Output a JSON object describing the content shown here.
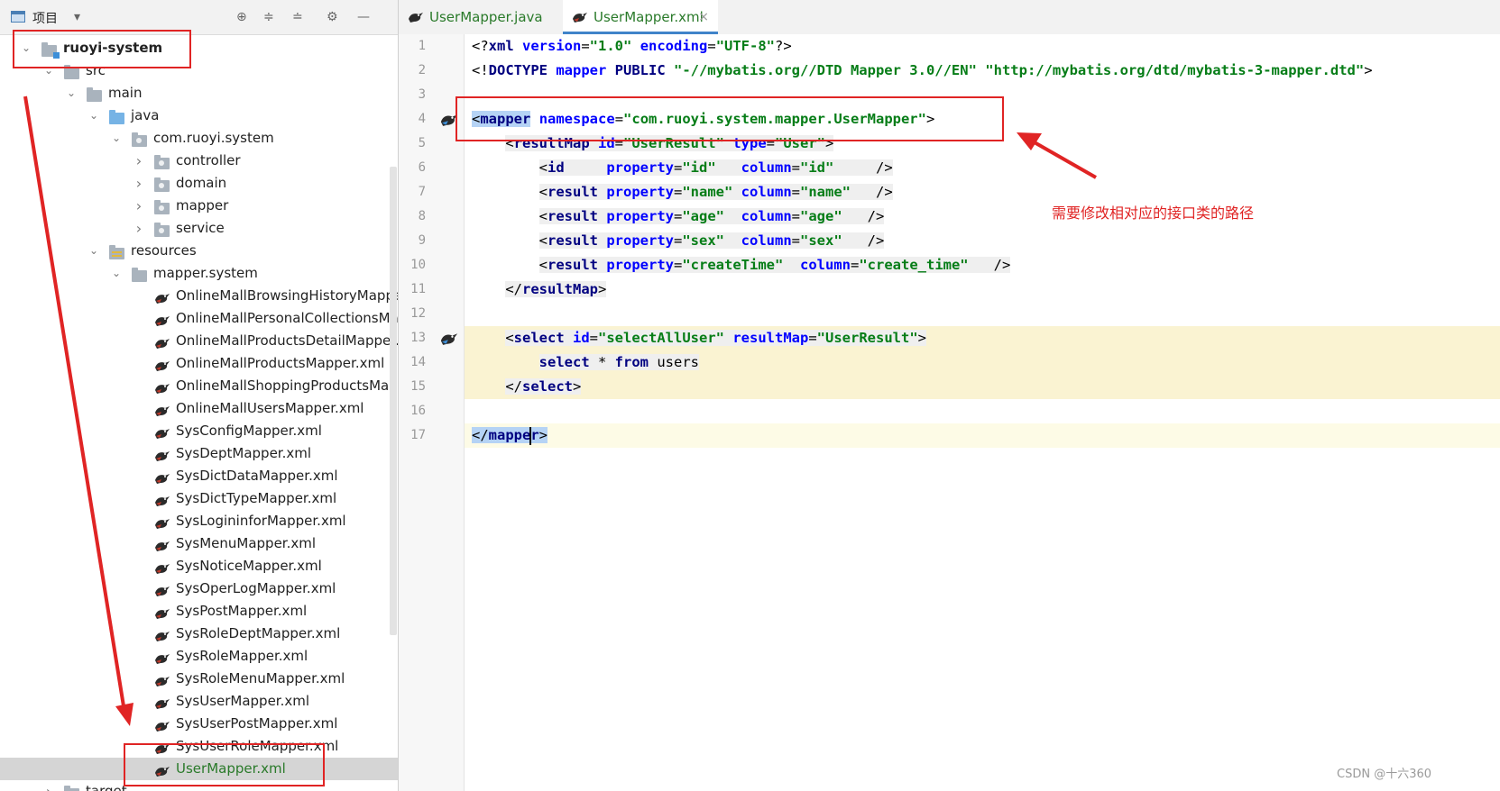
{
  "panel": {
    "title": "项目",
    "dropdown_icon": "caret-down-icon",
    "toolbar_icons": [
      "target-icon",
      "expand-all-icon",
      "collapse-all-icon",
      "gear-icon",
      "minimize-icon"
    ]
  },
  "tree": [
    {
      "label": "ruoyi-system",
      "depth": 0,
      "expanded": true,
      "icon": "module-folder-icon",
      "bold": true
    },
    {
      "label": "src",
      "depth": 1,
      "expanded": true,
      "icon": "folder-icon"
    },
    {
      "label": "main",
      "depth": 2,
      "expanded": true,
      "icon": "folder-icon"
    },
    {
      "label": "java",
      "depth": 3,
      "expanded": true,
      "icon": "source-folder-icon"
    },
    {
      "label": "com.ruoyi.system",
      "depth": 4,
      "expanded": true,
      "icon": "package-icon"
    },
    {
      "label": "controller",
      "depth": 5,
      "expanded": false,
      "icon": "package-icon"
    },
    {
      "label": "domain",
      "depth": 5,
      "expanded": false,
      "icon": "package-icon"
    },
    {
      "label": "mapper",
      "depth": 5,
      "expanded": false,
      "icon": "package-icon"
    },
    {
      "label": "service",
      "depth": 5,
      "expanded": false,
      "icon": "package-icon"
    },
    {
      "label": "resources",
      "depth": 3,
      "expanded": true,
      "icon": "resources-folder-icon"
    },
    {
      "label": "mapper.system",
      "depth": 4,
      "expanded": true,
      "icon": "folder-icon"
    },
    {
      "label": "OnlineMallBrowsingHistoryMapper.xml",
      "depth": 5,
      "icon": "mybatis-file-icon"
    },
    {
      "label": "OnlineMallPersonalCollectionsMapper.xml",
      "depth": 5,
      "icon": "mybatis-file-icon"
    },
    {
      "label": "OnlineMallProductsDetailMapper.xml",
      "depth": 5,
      "icon": "mybatis-file-icon"
    },
    {
      "label": "OnlineMallProductsMapper.xml",
      "depth": 5,
      "icon": "mybatis-file-icon"
    },
    {
      "label": "OnlineMallShoppingProductsMapper.xml",
      "depth": 5,
      "icon": "mybatis-file-icon"
    },
    {
      "label": "OnlineMallUsersMapper.xml",
      "depth": 5,
      "icon": "mybatis-file-icon"
    },
    {
      "label": "SysConfigMapper.xml",
      "depth": 5,
      "icon": "mybatis-file-icon"
    },
    {
      "label": "SysDeptMapper.xml",
      "depth": 5,
      "icon": "mybatis-file-icon"
    },
    {
      "label": "SysDictDataMapper.xml",
      "depth": 5,
      "icon": "mybatis-file-icon"
    },
    {
      "label": "SysDictTypeMapper.xml",
      "depth": 5,
      "icon": "mybatis-file-icon"
    },
    {
      "label": "SysLogininforMapper.xml",
      "depth": 5,
      "icon": "mybatis-file-icon"
    },
    {
      "label": "SysMenuMapper.xml",
      "depth": 5,
      "icon": "mybatis-file-icon"
    },
    {
      "label": "SysNoticeMapper.xml",
      "depth": 5,
      "icon": "mybatis-file-icon"
    },
    {
      "label": "SysOperLogMapper.xml",
      "depth": 5,
      "icon": "mybatis-file-icon"
    },
    {
      "label": "SysPostMapper.xml",
      "depth": 5,
      "icon": "mybatis-file-icon"
    },
    {
      "label": "SysRoleDeptMapper.xml",
      "depth": 5,
      "icon": "mybatis-file-icon"
    },
    {
      "label": "SysRoleMapper.xml",
      "depth": 5,
      "icon": "mybatis-file-icon"
    },
    {
      "label": "SysRoleMenuMapper.xml",
      "depth": 5,
      "icon": "mybatis-file-icon"
    },
    {
      "label": "SysUserMapper.xml",
      "depth": 5,
      "icon": "mybatis-file-icon"
    },
    {
      "label": "SysUserPostMapper.xml",
      "depth": 5,
      "icon": "mybatis-file-icon"
    },
    {
      "label": "SysUserRoleMapper.xml",
      "depth": 5,
      "icon": "mybatis-file-icon"
    },
    {
      "label": "UserMapper.xml",
      "depth": 5,
      "icon": "mybatis-file-icon",
      "selected": true
    },
    {
      "label": "target",
      "depth": 1,
      "expanded": false,
      "icon": "folder-icon"
    }
  ],
  "tabs": [
    {
      "label": "UserMapper.java",
      "active": false,
      "icon": "mybatis-java-icon"
    },
    {
      "label": "UserMapper.xml",
      "active": true,
      "icon": "mybatis-file-icon",
      "close": "×"
    }
  ],
  "code_lines": [
    {
      "n": "1",
      "segs": [
        [
          "pun",
          "<?"
        ],
        [
          "tagn",
          "xml "
        ],
        [
          "att",
          "version"
        ],
        [
          "pun",
          "="
        ],
        [
          "val",
          "\"1.0\""
        ],
        [
          "pun",
          " "
        ],
        [
          "att",
          "encoding"
        ],
        [
          "pun",
          "="
        ],
        [
          "val",
          "\"UTF-8\""
        ],
        [
          "pun",
          "?>"
        ]
      ]
    },
    {
      "n": "2",
      "segs": [
        [
          "pun",
          "<!"
        ],
        [
          "tagn",
          "DOCTYPE "
        ],
        [
          "att",
          "mapper "
        ],
        [
          "kw",
          "PUBLIC "
        ],
        [
          "val",
          "\"-//mybatis.org//DTD Mapper 3.0//EN\""
        ],
        [
          "pun",
          " "
        ],
        [
          "val",
          "\"http://mybatis.org/dtd/mybatis-3-mapper.dtd\""
        ],
        [
          "pun",
          ">"
        ]
      ]
    },
    {
      "n": "3",
      "segs": []
    },
    {
      "n": "4",
      "segs": [
        [
          "pun",
          "<"
        ],
        [
          "tagn",
          "mapper"
        ],
        [
          "pun",
          " "
        ],
        [
          "att",
          "namespace"
        ],
        [
          "pun",
          "="
        ],
        [
          "val",
          "\"com.ruoyi.system.mapper.UserMapper\""
        ],
        [
          "pun",
          ">"
        ]
      ]
    },
    {
      "n": "5",
      "segs": [
        [
          "plain",
          "    "
        ],
        [
          "pun",
          "<"
        ],
        [
          "tagn",
          "resultMap "
        ],
        [
          "att",
          "id"
        ],
        [
          "pun",
          "="
        ],
        [
          "val",
          "\"UserResult\" "
        ],
        [
          "att",
          "type"
        ],
        [
          "pun",
          "="
        ],
        [
          "val",
          "\"User\""
        ],
        [
          "pun",
          ">"
        ]
      ]
    },
    {
      "n": "6",
      "segs": [
        [
          "plain",
          "        "
        ],
        [
          "pun",
          "<"
        ],
        [
          "tagn",
          "id     "
        ],
        [
          "att",
          "property"
        ],
        [
          "pun",
          "="
        ],
        [
          "val",
          "\"id\"   "
        ],
        [
          "att",
          "column"
        ],
        [
          "pun",
          "="
        ],
        [
          "val",
          "\"id\"     "
        ],
        [
          "pun",
          "/>"
        ]
      ]
    },
    {
      "n": "7",
      "segs": [
        [
          "plain",
          "        "
        ],
        [
          "pun",
          "<"
        ],
        [
          "tagn",
          "result "
        ],
        [
          "att",
          "property"
        ],
        [
          "pun",
          "="
        ],
        [
          "val",
          "\"name\" "
        ],
        [
          "att",
          "column"
        ],
        [
          "pun",
          "="
        ],
        [
          "val",
          "\"name\"   "
        ],
        [
          "pun",
          "/>"
        ]
      ]
    },
    {
      "n": "8",
      "segs": [
        [
          "plain",
          "        "
        ],
        [
          "pun",
          "<"
        ],
        [
          "tagn",
          "result "
        ],
        [
          "att",
          "property"
        ],
        [
          "pun",
          "="
        ],
        [
          "val",
          "\"age\"  "
        ],
        [
          "att",
          "column"
        ],
        [
          "pun",
          "="
        ],
        [
          "val",
          "\"age\"   "
        ],
        [
          "pun",
          "/>"
        ]
      ]
    },
    {
      "n": "9",
      "segs": [
        [
          "plain",
          "        "
        ],
        [
          "pun",
          "<"
        ],
        [
          "tagn",
          "result "
        ],
        [
          "att",
          "property"
        ],
        [
          "pun",
          "="
        ],
        [
          "val",
          "\"sex\"  "
        ],
        [
          "att",
          "column"
        ],
        [
          "pun",
          "="
        ],
        [
          "val",
          "\"sex\"   "
        ],
        [
          "pun",
          "/>"
        ]
      ]
    },
    {
      "n": "10",
      "segs": [
        [
          "plain",
          "        "
        ],
        [
          "pun",
          "<"
        ],
        [
          "tagn",
          "result "
        ],
        [
          "att",
          "property"
        ],
        [
          "pun",
          "="
        ],
        [
          "val",
          "\"createTime\"  "
        ],
        [
          "att",
          "column"
        ],
        [
          "pun",
          "="
        ],
        [
          "val",
          "\"create_time\"   "
        ],
        [
          "pun",
          "/>"
        ]
      ]
    },
    {
      "n": "11",
      "segs": [
        [
          "plain",
          "    "
        ],
        [
          "pun",
          "</"
        ],
        [
          "tagn",
          "resultMap"
        ],
        [
          "pun",
          ">"
        ]
      ]
    },
    {
      "n": "12",
      "segs": []
    },
    {
      "n": "13",
      "segs": [
        [
          "plain",
          "    "
        ],
        [
          "pun",
          "<"
        ],
        [
          "tagn",
          "select "
        ],
        [
          "att",
          "id"
        ],
        [
          "pun",
          "="
        ],
        [
          "val",
          "\"selectAllUser\" "
        ],
        [
          "att",
          "resultMap"
        ],
        [
          "pun",
          "="
        ],
        [
          "val",
          "\"UserResult\""
        ],
        [
          "pun",
          ">"
        ]
      ]
    },
    {
      "n": "14",
      "segs": [
        [
          "plain",
          "        "
        ],
        [
          "kw",
          "select "
        ],
        [
          "plain",
          "* "
        ],
        [
          "kw",
          "from "
        ],
        [
          "plain",
          "users"
        ]
      ]
    },
    {
      "n": "15",
      "segs": [
        [
          "plain",
          "    "
        ],
        [
          "pun",
          "</"
        ],
        [
          "tagn",
          "select"
        ],
        [
          "pun",
          ">"
        ]
      ]
    },
    {
      "n": "16",
      "segs": []
    },
    {
      "n": "17",
      "segs": [
        [
          "pun",
          "</"
        ],
        [
          "tagn",
          "mapper"
        ],
        [
          "pun",
          ">"
        ]
      ]
    }
  ],
  "annotation": "需要修改相对应的接口类的路径",
  "watermark": "CSDN @十六360",
  "colors": {
    "annotation_red": "#e02424",
    "tag": "#000080",
    "attr": "#0000ff",
    "string": "#067d17",
    "selection": "#b5d3f5"
  }
}
